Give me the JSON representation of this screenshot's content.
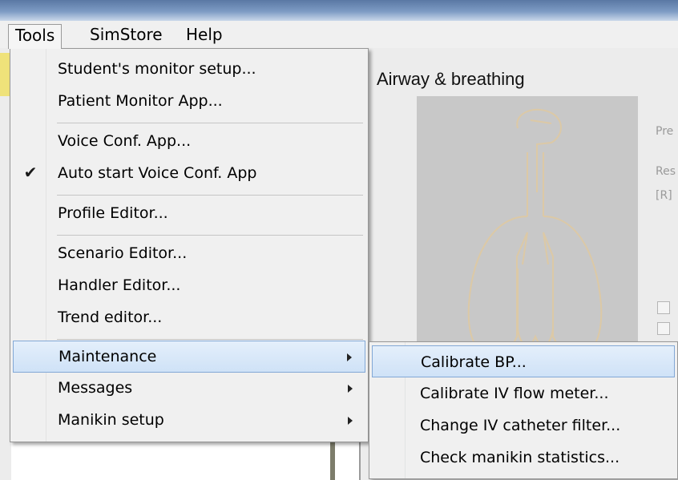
{
  "menubar": {
    "items": [
      {
        "label": "Tools"
      },
      {
        "label": "SimStore"
      },
      {
        "label": "Help"
      }
    ]
  },
  "background": {
    "panel_title": "Airway & breathing",
    "faint_labels": [
      "Pre",
      "Res",
      "[R]"
    ]
  },
  "tools_menu": {
    "items": [
      {
        "label": "Student's monitor setup..."
      },
      {
        "label": "Patient Monitor App..."
      },
      {
        "label": "Voice Conf. App..."
      },
      {
        "label": "Auto start Voice Conf. App",
        "checked": true
      },
      {
        "label": "Profile Editor..."
      },
      {
        "label": "Scenario Editor..."
      },
      {
        "label": "Handler Editor..."
      },
      {
        "label": "Trend editor..."
      },
      {
        "label": "Maintenance",
        "submenu": true,
        "highlighted": true
      },
      {
        "label": "Messages",
        "submenu": true
      },
      {
        "label": "Manikin setup",
        "submenu": true
      }
    ]
  },
  "maintenance_submenu": {
    "items": [
      {
        "label": "Calibrate BP...",
        "highlighted": true
      },
      {
        "label": "Calibrate IV flow meter..."
      },
      {
        "label": "Change IV catheter filter..."
      },
      {
        "label": "Check manikin statistics..."
      }
    ]
  },
  "icons": {
    "check": "check-icon",
    "submenu_arrow": "chevron-right-icon"
  },
  "colors": {
    "highlight_border": "#82a8d6",
    "highlight_fill": "#cfe2f7",
    "menu_background": "#f0f0f0",
    "anatomy_outline": "#dcc9a6"
  }
}
